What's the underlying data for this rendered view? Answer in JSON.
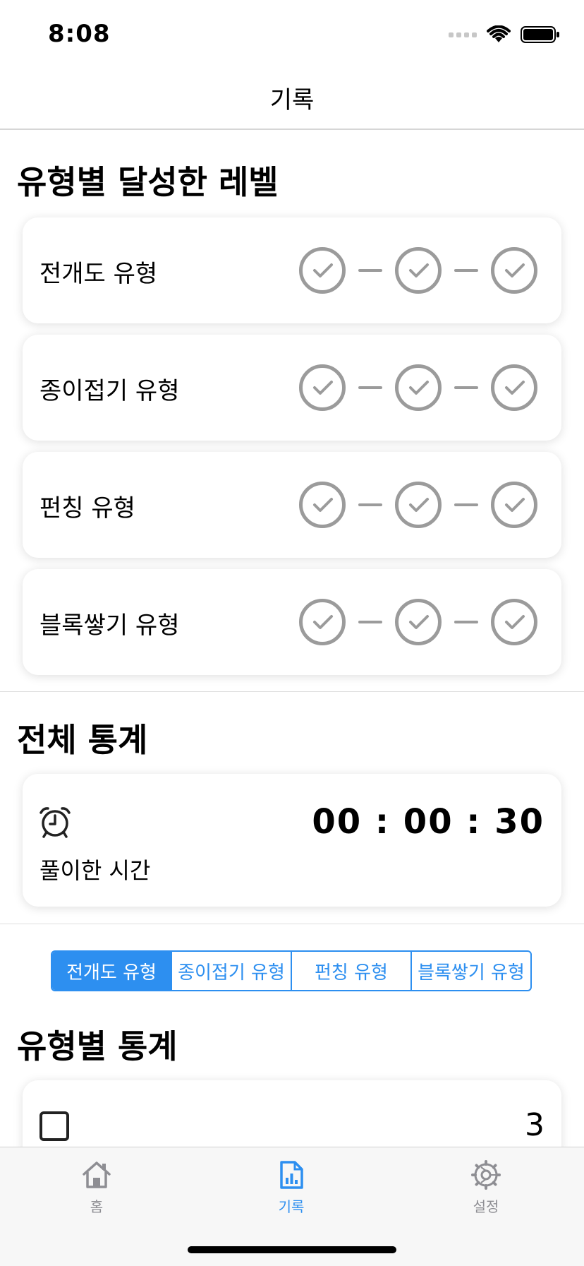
{
  "status": {
    "time": "8:08"
  },
  "nav": {
    "title": "기록"
  },
  "levels": {
    "title": "유형별 달성한 레벨",
    "items": [
      {
        "label": "전개도 유형",
        "achieved": 3
      },
      {
        "label": "종이접기 유형",
        "achieved": 3
      },
      {
        "label": "펀칭 유형",
        "achieved": 3
      },
      {
        "label": "블록쌓기 유형",
        "achieved": 3
      }
    ]
  },
  "overall": {
    "title": "전체 통계",
    "time_label": "풀이한 시간",
    "time_value": "00 : 00 : 30",
    "icon": "alarm-clock-icon"
  },
  "segments": {
    "options": [
      "전개도 유형",
      "종이접기 유형",
      "펀칭 유형",
      "블록쌓기 유형"
    ],
    "selected": "전개도 유형"
  },
  "by_type": {
    "title": "유형별 통계",
    "first_stat_value": "3",
    "icon": "square-icon"
  },
  "tabs": [
    {
      "label": "홈",
      "icon": "home-icon",
      "active": false
    },
    {
      "label": "기록",
      "icon": "document-chart-icon",
      "active": true
    },
    {
      "label": "설정",
      "icon": "gear-icon",
      "active": false
    }
  ],
  "colors": {
    "accent": "#2d8ff0",
    "check_gray": "#9b9b9b",
    "tab_inactive": "#8e8e93"
  }
}
